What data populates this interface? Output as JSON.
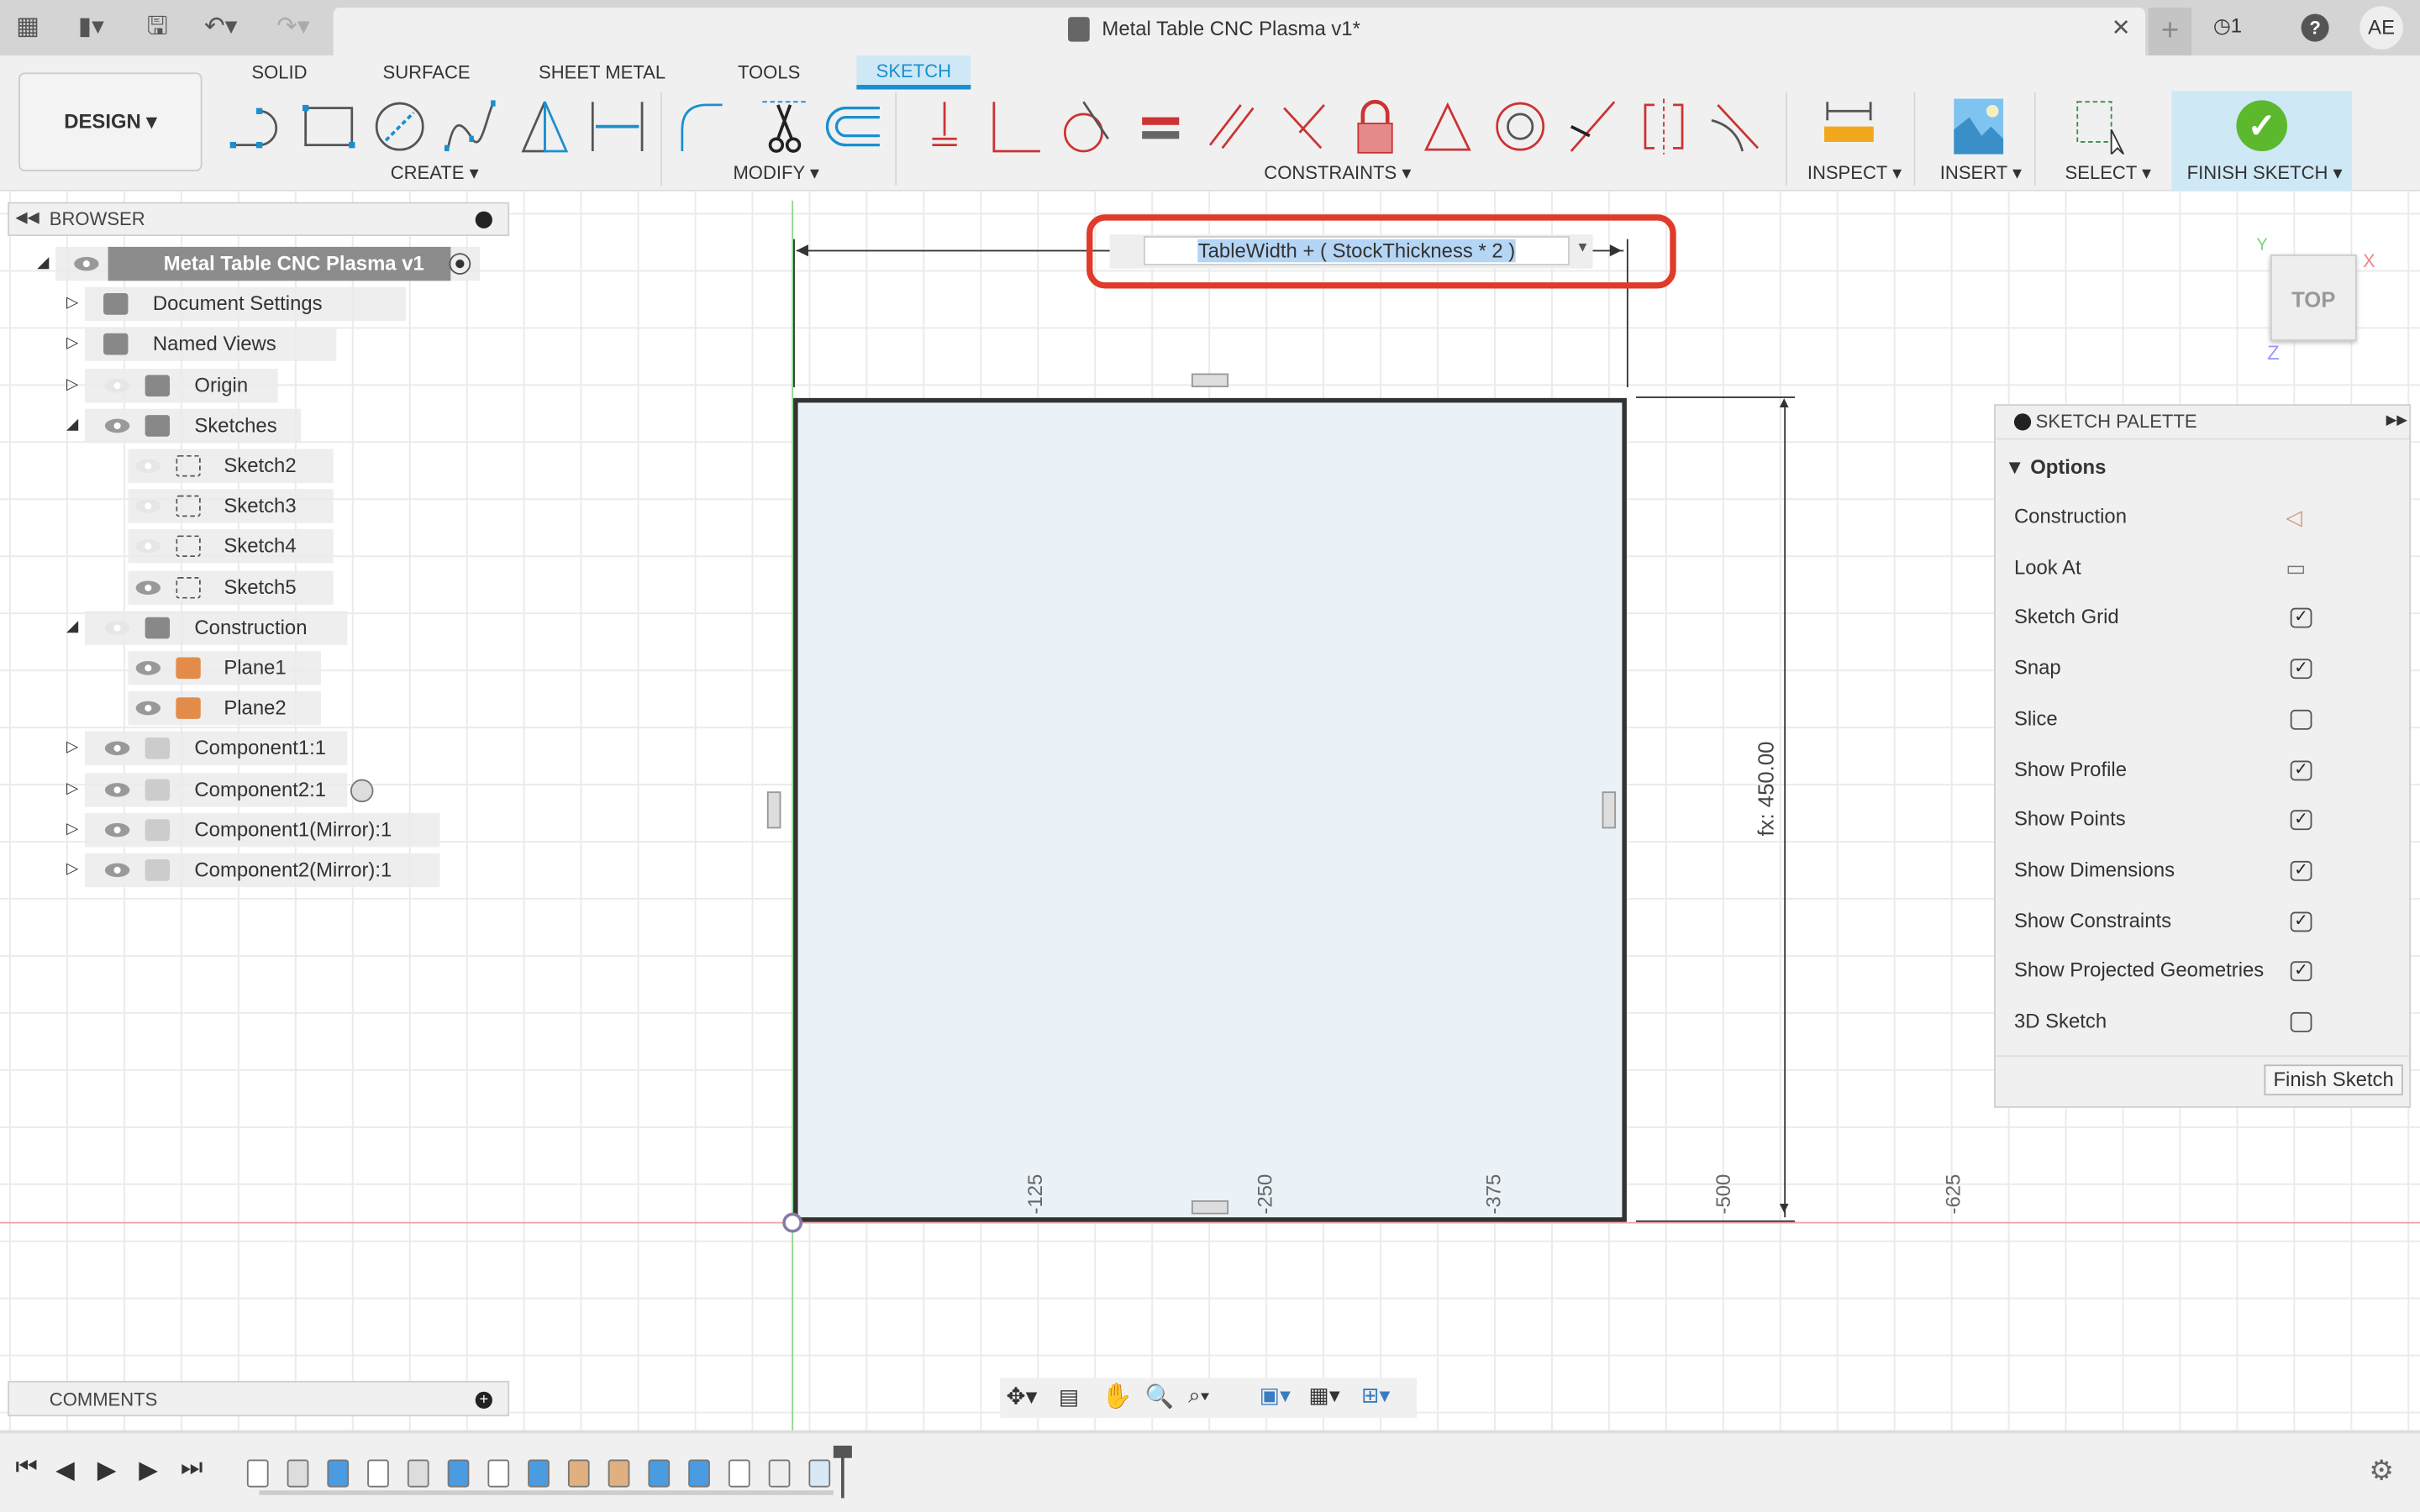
{
  "window": {
    "title": "Metal Table CNC Plasma v1*",
    "job_count": "1",
    "user_initials": "AE"
  },
  "workspace": {
    "label": "DESIGN"
  },
  "tabs": [
    {
      "label": "SOLID"
    },
    {
      "label": "SURFACE"
    },
    {
      "label": "SHEET METAL"
    },
    {
      "label": "TOOLS"
    },
    {
      "label": "SKETCH",
      "active": true
    }
  ],
  "groups": {
    "create": "CREATE",
    "modify": "MODIFY",
    "constraints": "CONSTRAINTS",
    "inspect": "INSPECT",
    "insert": "INSERT",
    "select": "SELECT",
    "finish": "FINISH SKETCH"
  },
  "browser": {
    "title": "BROWSER",
    "items": [
      {
        "label": "Metal Table CNC Plasma v1",
        "icon": "component-icon",
        "expanded": true
      },
      {
        "label": "Document Settings",
        "icon": "gear-icon"
      },
      {
        "label": "Named Views",
        "icon": "folder-icon"
      },
      {
        "label": "Origin",
        "icon": "folder-icon",
        "hidden": true
      },
      {
        "label": "Sketches",
        "icon": "folder-icon",
        "expanded": true
      },
      {
        "label": "Sketch2",
        "icon": "sketch-locked-icon",
        "hidden": true
      },
      {
        "label": "Sketch3",
        "icon": "sketch-edit-icon",
        "hidden": true
      },
      {
        "label": "Sketch4",
        "icon": "sketch-locked-icon",
        "hidden": true
      },
      {
        "label": "Sketch5",
        "icon": "sketch-locked-icon"
      },
      {
        "label": "Construction",
        "icon": "folder-icon",
        "hidden": true,
        "expanded": true
      },
      {
        "label": "Plane1",
        "icon": "plane-icon"
      },
      {
        "label": "Plane2",
        "icon": "plane-icon"
      },
      {
        "label": "Component1:1",
        "icon": "body-icon"
      },
      {
        "label": "Component2:1",
        "icon": "body-icon"
      },
      {
        "label": "Component1(Mirror):1",
        "icon": "body-icon"
      },
      {
        "label": "Component2(Mirror):1",
        "icon": "body-icon"
      }
    ]
  },
  "dimension": {
    "expression": "TableWidth + ( StockThickness * 2 )",
    "vertical": "fx: 450.00"
  },
  "axis_labels": [
    "-125",
    "-250",
    "-375",
    "-500",
    "-625"
  ],
  "viewcube": {
    "face": "TOP",
    "x": "X",
    "y": "Y",
    "z": "Z"
  },
  "palette": {
    "title": "SKETCH PALETTE",
    "section": "Options",
    "options": [
      {
        "label": "Construction",
        "type": "icon"
      },
      {
        "label": "Look At",
        "type": "icon"
      },
      {
        "label": "Sketch Grid",
        "checked": true
      },
      {
        "label": "Snap",
        "checked": true
      },
      {
        "label": "Slice",
        "checked": false
      },
      {
        "label": "Show Profile",
        "checked": true
      },
      {
        "label": "Show Points",
        "checked": true
      },
      {
        "label": "Show Dimensions",
        "checked": true
      },
      {
        "label": "Show Constraints",
        "checked": true
      },
      {
        "label": "Show Projected Geometries",
        "checked": true
      },
      {
        "label": "3D Sketch",
        "checked": false
      }
    ],
    "finish_label": "Finish Sketch"
  },
  "comments": {
    "title": "COMMENTS"
  },
  "colors": {
    "accent": "#1a8fd0",
    "highlight": "#e03a2a",
    "finish": "#5cb82c",
    "profile": "#eaf2f8"
  }
}
